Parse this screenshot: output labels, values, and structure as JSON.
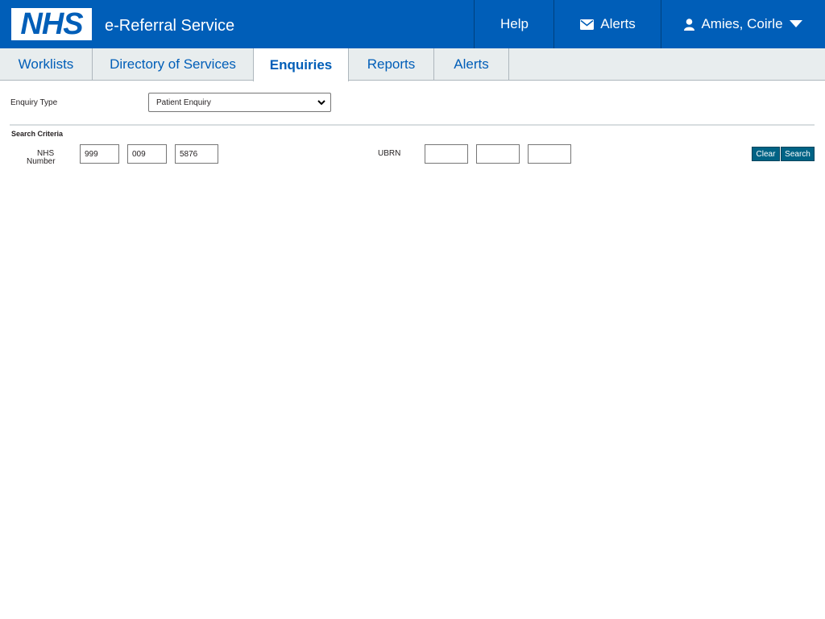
{
  "header": {
    "logo_text": "NHS",
    "service_name": "e-Referral Service",
    "help_label": "Help",
    "alerts_label": "Alerts",
    "user_name": "Amies, Coirle"
  },
  "tabs": [
    {
      "label": "Worklists",
      "active": false
    },
    {
      "label": "Directory of Services",
      "active": false
    },
    {
      "label": "Enquiries",
      "active": true
    },
    {
      "label": "Reports",
      "active": false
    },
    {
      "label": "Alerts",
      "active": false
    }
  ],
  "enquiry": {
    "type_label": "Enquiry Type",
    "type_value": "Patient Enquiry"
  },
  "search": {
    "section_title": "Search Criteria",
    "nhs_label_line1": "NHS",
    "nhs_label_line2": "Number",
    "nhs_number": [
      "999",
      "009",
      "5876"
    ],
    "ubrn_label": "UBRN",
    "ubrn": [
      "",
      "",
      ""
    ],
    "clear_label": "Clear",
    "search_label": "Search"
  },
  "colors": {
    "brand_blue": "#005eb8",
    "button_teal": "#006385",
    "tab_bar_bg": "#e8edee"
  }
}
